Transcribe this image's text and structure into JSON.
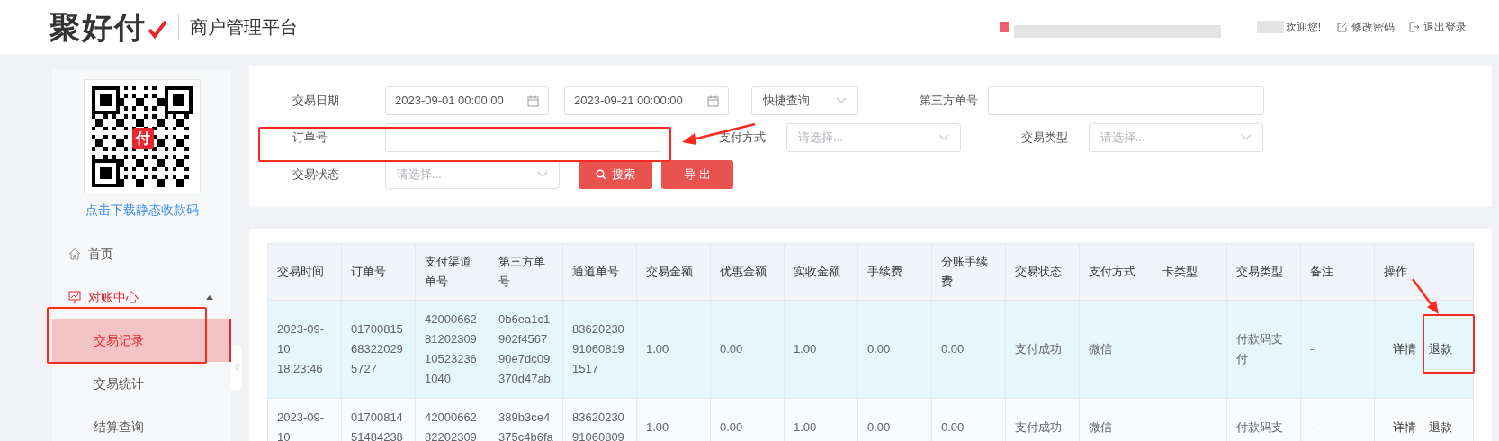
{
  "header": {
    "logo": "聚好付",
    "title": "商户管理平台",
    "welcome": "欢迎您!",
    "links": [
      {
        "label": "修改密码",
        "kind": "edit"
      },
      {
        "label": "退出登录",
        "kind": "logout"
      }
    ]
  },
  "sidebar": {
    "qr_badge": "付",
    "download_link": "点击下载静态收款码",
    "items": [
      {
        "label": "首页",
        "kind": "home",
        "selected": false
      },
      {
        "label": "对账中心",
        "kind": "reconcile",
        "selected": true,
        "expanded": true,
        "children": [
          {
            "label": "交易记录",
            "selected": true
          },
          {
            "label": "交易统计",
            "selected": false
          },
          {
            "label": "结算查询",
            "selected": false
          }
        ]
      }
    ]
  },
  "filters": [
    [
      {
        "kind": "label",
        "text": "交易日期"
      },
      {
        "kind": "date",
        "value": "2023-09-01 00:00:00"
      },
      {
        "kind": "date",
        "value": "2023-09-21 00:00:00"
      },
      {
        "kind": "select",
        "value": "快捷查询"
      },
      {
        "kind": "label",
        "text": "第三方单号"
      },
      {
        "kind": "text"
      }
    ],
    [
      {
        "kind": "label",
        "text": "订单号"
      },
      {
        "kind": "text"
      },
      {
        "kind": "label",
        "text": "支付方式"
      },
      {
        "kind": "select",
        "placeholder": "请选择..."
      },
      {
        "kind": "label",
        "text": "交易类型"
      },
      {
        "kind": "select",
        "placeholder": "请选择..."
      }
    ],
    [
      {
        "kind": "label",
        "text": "交易状态"
      },
      {
        "kind": "select",
        "placeholder": "请选择..."
      },
      {
        "kind": "search_button",
        "label": "搜索"
      },
      {
        "kind": "button",
        "label": "导 出"
      }
    ]
  ],
  "table": {
    "columns": [
      "交易时间",
      "订单号",
      "支付渠道单号",
      "第三方单号",
      "通道单号",
      "交易金额",
      "优惠金额",
      "实收金额",
      "手续费",
      "分账手续费",
      "交易状态",
      "支付方式",
      "卡类型",
      "交易类型",
      "备注",
      "操作"
    ],
    "rows": [
      {
        "selected": true,
        "cells": [
          "2023-09-10 18:23:46",
          "01700815683220295727",
          "4200066281202309105232361040",
          "0b6ea1c1902f456790e7dc09370d47ab",
          "83620230910608191517",
          "1.00",
          "0.00",
          "1.00",
          "0.00",
          "0.00",
          "支付成功",
          "微信",
          "",
          "付款码支付",
          "-"
        ],
        "actions": [
          "详情",
          "退款"
        ]
      },
      {
        "selected": false,
        "cells": [
          "2023-09-10",
          "0170081451484238",
          "4200066282202309",
          "389b3ce4375c4b6fa",
          "8362023091060809",
          "1.00",
          "0.00",
          "1.00",
          "0.00",
          "0.00",
          "支付成功",
          "微信",
          "",
          "付款码支",
          "-"
        ],
        "actions": [
          "详情",
          "退款"
        ]
      }
    ]
  }
}
